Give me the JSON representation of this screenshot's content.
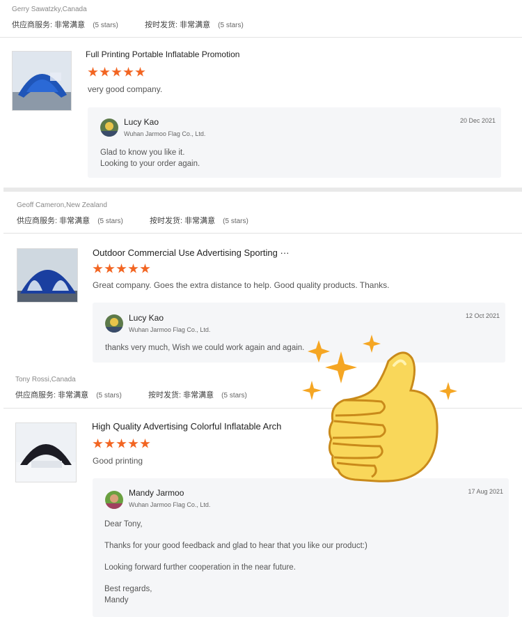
{
  "rating_labels": {
    "service": "供应商服务:",
    "delivery": "按时发货:",
    "value": "非常满意",
    "stars": "(5 stars)"
  },
  "reviews": [
    {
      "customer": "Gerry Sawatzky,Canada",
      "product": "Full Printing Portable Inflatable Promotion",
      "comment": "very good company.",
      "reply": {
        "name": "Lucy Kao",
        "company": "Wuhan Jarmoo Flag Co., Ltd.",
        "date": "20 Dec 2021",
        "lines": [
          "Glad to know you like it.",
          "Looking to your order again."
        ]
      }
    },
    {
      "customer": "Geoff Cameron,New Zealand",
      "product": "Outdoor Commercial Use Advertising Sporting ···",
      "comment": "Great company. Goes the extra distance to help. Good quality products. Thanks.",
      "reply": {
        "name": "Lucy Kao",
        "company": "Wuhan Jarmoo Flag Co., Ltd.",
        "date": "12 Oct 2021",
        "lines": [
          "thanks very much, Wish we could work again and again."
        ]
      }
    },
    {
      "customer": "Tony Rossi,Canada",
      "product": "High Quality Advertising Colorful Inflatable Arch",
      "comment": "Good printing",
      "reply": {
        "name": "Mandy Jarmoo",
        "company": "Wuhan Jarmoo Flag Co., Ltd.",
        "date": "17 Aug 2021",
        "lines": [
          "Dear Tony,",
          "Thanks for your good feedback and glad to hear that you like our product:)",
          "Looking forward further cooperation in the near future.",
          "Best regards,",
          "Mandy"
        ]
      }
    }
  ],
  "colors": {
    "star": "#f26522",
    "reply_bg": "#f5f6f8",
    "thumb_up": "#f9d75a",
    "sparkle": "#f5a623"
  },
  "decoration_icon": "thumbs-up-icon"
}
